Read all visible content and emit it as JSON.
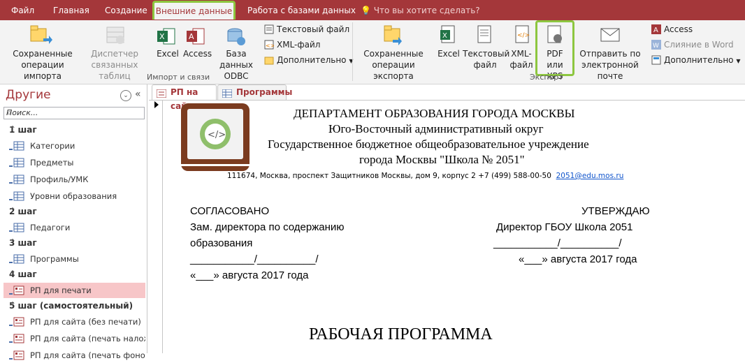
{
  "menu": {
    "items": [
      "Файл",
      "Главная",
      "Создание",
      "Внешние данные",
      "Работа с базами данных"
    ],
    "tell_me": "Что вы хотите сделать?"
  },
  "ribbon": {
    "import": {
      "saved_imports": "Сохраненные операции импорта",
      "linked_table_manager": "Диспетчер связанных таблиц",
      "excel": "Excel",
      "access": "Access",
      "odbc": "База данных ODBC",
      "text_file": "Текстовый файл",
      "xml_file": "XML-файл",
      "more": "Дополнительно",
      "group_label": "Импорт и связи"
    },
    "export": {
      "saved_exports": "Сохраненные операции экспорта",
      "excel": "Excel",
      "text_file": "Текстовый файл",
      "xml_file": "XML-файл",
      "pdf_xps": "PDF или XPS",
      "email": "Отправить по электронной почте",
      "access": "Access",
      "word_merge": "Слияние в Word",
      "more": "Дополнительно",
      "group_label": "Экспорт"
    }
  },
  "nav": {
    "title": "Другие",
    "search_placeholder": "Поиск...",
    "sections": [
      {
        "label": "1 шаг",
        "items": [
          "Категории",
          "Предметы",
          "Профиль/УМК",
          "Уровни образования"
        ]
      },
      {
        "label": "2 шаг",
        "items": [
          "Педагоги"
        ]
      },
      {
        "label": "3 шаг",
        "items": [
          "Программы"
        ]
      },
      {
        "label": "4 шаг",
        "items": [
          "РП для печати"
        ]
      },
      {
        "label": "5 шаг (самостоятельный)",
        "items": [
          "РП для сайта (без печати)",
          "РП для сайта (печать налож…",
          "РП для сайта (печать фоном)"
        ]
      }
    ]
  },
  "tabs": [
    "РП на сайт",
    "Программы"
  ],
  "document": {
    "header_lines": [
      "ДЕПАРТАМЕНТ ОБРАЗОВАНИЯ ГОРОДА МОСКВЫ",
      "Юго-Восточный административный округ",
      "Государственное бюджетное общеобразовательное учреждение",
      "города Москвы \"Школа № 2051\""
    ],
    "address": "111674, Москва, проспект Защитников Москвы, дом 9, корпус 2  +7 (499) 588-00-50",
    "email": "2051@edu.mos.ru",
    "left_block": [
      "СОГЛАСОВАНО",
      "Зам. директора по содержанию",
      "образования",
      "___________/__________/",
      "«___» августа 2017 года"
    ],
    "right_block": [
      "УТВЕРЖДАЮ",
      "Директор ГБОУ Школа 2051",
      "___________/__________/",
      "«___» августа 2017 года"
    ],
    "title": "РАБОЧАЯ ПРОГРАММА"
  },
  "colors": {
    "accent": "#a4373a",
    "highlight": "#8dc63f",
    "selected": "#f7c6c8"
  }
}
